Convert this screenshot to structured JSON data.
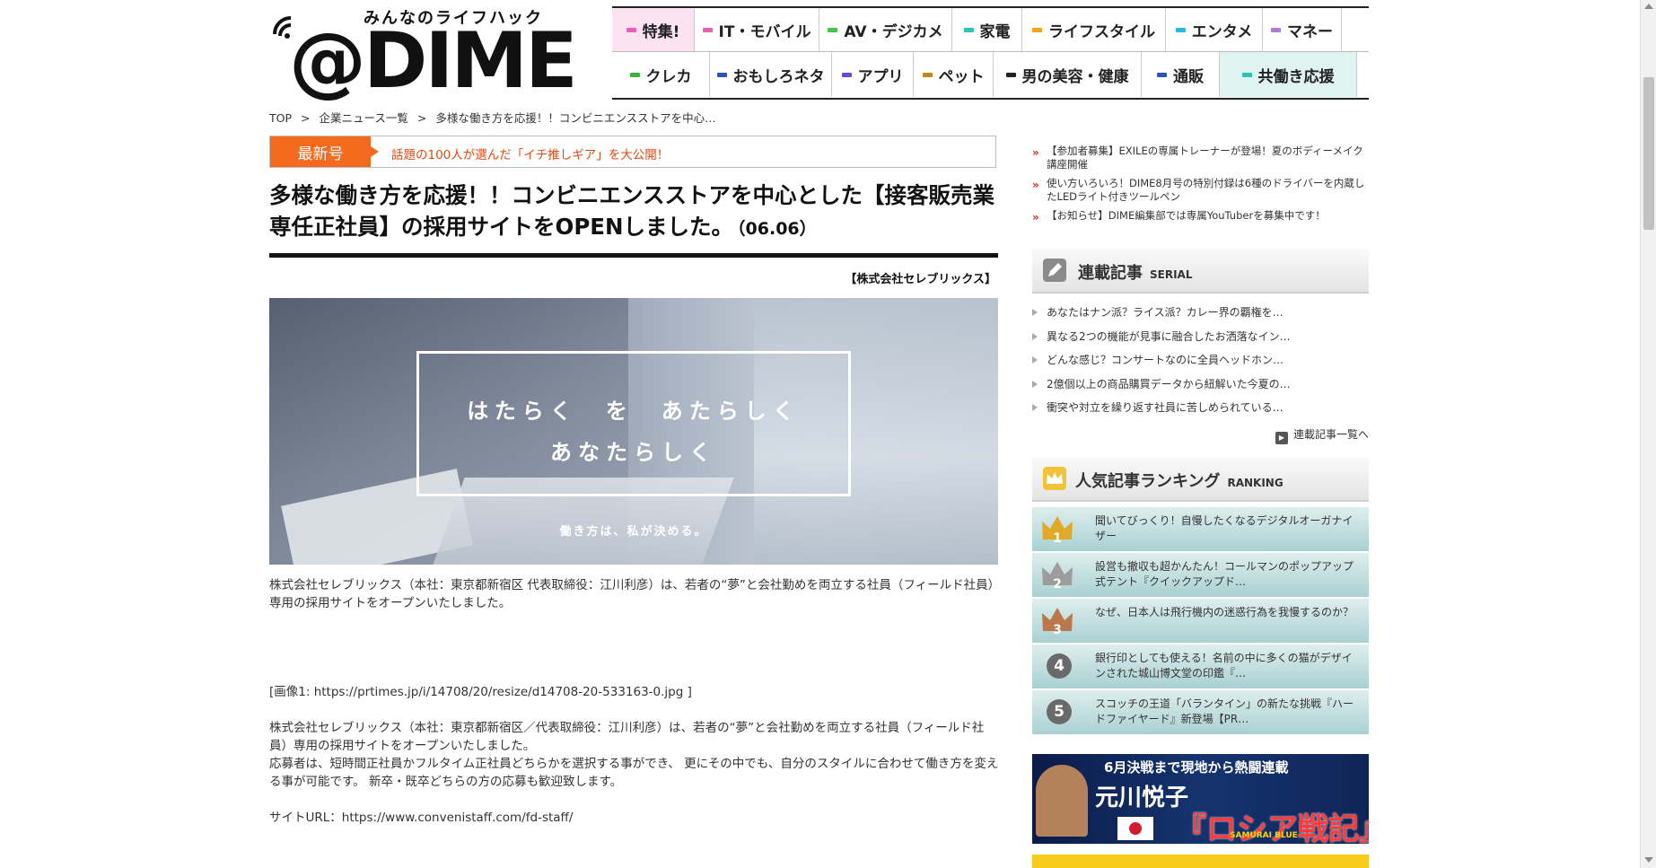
{
  "logo": {
    "tagline": "みんなのライフハック",
    "name": "@DIME"
  },
  "nav": {
    "row1": [
      {
        "label": "特集!",
        "color": "#e85fb5",
        "bg": "#fbe3f2"
      },
      {
        "label": "IT・モバイル",
        "color": "#e85fb5",
        "bg": "#ffffff"
      },
      {
        "label": "AV・デジカメ",
        "color": "#49c24a",
        "bg": "#ffffff"
      },
      {
        "label": "家電",
        "color": "#2ec2b0",
        "bg": "#ffffff"
      },
      {
        "label": "ライフスタイル",
        "color": "#f2a21d",
        "bg": "#ffffff"
      },
      {
        "label": "エンタメ",
        "color": "#2bb5e0",
        "bg": "#ffffff"
      },
      {
        "label": "マネー",
        "color": "#b17ad6",
        "bg": "#ffffff"
      }
    ],
    "row2": [
      {
        "label": "クレカ",
        "color": "#3bb03b",
        "bg": "#ffffff"
      },
      {
        "label": "おもしろネタ",
        "color": "#2a55b8",
        "bg": "#ffffff"
      },
      {
        "label": "アプリ",
        "color": "#6a4bc4",
        "bg": "#ffffff"
      },
      {
        "label": "ペット",
        "color": "#b88a22",
        "bg": "#ffffff"
      },
      {
        "label": "男の美容・健康",
        "color": "#222222",
        "bg": "#ffffff"
      },
      {
        "label": "通販",
        "color": "#2a55b8",
        "bg": "#ffffff"
      },
      {
        "label": "共働き応援",
        "color": "#2ec2b0",
        "bg": "#dff3f1"
      }
    ]
  },
  "breadcrumb": [
    "TOP",
    ">",
    "企業ニュース一覧",
    ">",
    "多様な働き方を応援！！コンビニエンスストアを中心…"
  ],
  "latest": {
    "tag": "最新号",
    "link": "話題の100人が選んだ「イチ推しギア」を大公開！"
  },
  "article": {
    "title": "多様な働き方を応援！！コンビニエンスストアを中心とした【接客販売業 専任正社員】の採用サイトをOPENしました。",
    "date": "（06.06）",
    "company": "【株式会社セレブリックス】",
    "hero": {
      "line1": "はたらく　を　あたらしく",
      "line2": "あなたらしく",
      "sub": "働き方は、私が決める。"
    },
    "para1": "株式会社セレブリックス（本社：東京都新宿区 代表取締役：江川利彦）は、若者の“夢”と会社勤めを両立する社員（フィールド社員）専用の採用サイトをオープンいたしました。",
    "image_ref": "[画像1: https://prtimes.jp/i/14708/20/resize/d14708-20-533163-0.jpg ]",
    "para2": "株式会社セレブリックス（本社：東京都新宿区／代表取締役：江川利彦）は、若者の“夢”と会社勤めを両立する社員（フィールド社員）専用の採用サイトをオープンいたしました。",
    "para3": "応募者は、短時間正社員かフルタイム正社員どちらかを選択する事ができ、 更にその中でも、自分のスタイルに合わせて働き方を変える事が可能です。 新卒・既卒どちらの方の応募も歓迎致します。",
    "site_url": "サイトURL：https://www.convenistaff.com/fd-staff/"
  },
  "sidebar": {
    "news": [
      "【参加者募集】EXILEの専属トレーナーが登場！夏のボディーメイク講座開催",
      "使い方いろいろ！DIME8月号の特別付録は6種のドライバーを内蔵したLEDライト付きツールペン",
      "【お知らせ】DIME編集部では専属YouTuberを募集中です！"
    ],
    "serial": {
      "title": "連載記事",
      "en": "SERIAL",
      "items": [
        "あなたはナン派？ライス派？カレー界の覇権を…",
        "異なる2つの機能が見事に融合したお洒落なイン…",
        "どんな感じ？コンサートなのに全員ヘッドホン…",
        "2億個以上の商品購買データから紐解いた今夏の…",
        "衝突や対立を繰り返す社員に苦しめられている…"
      ],
      "more": "連載記事一覧へ"
    },
    "ranking": {
      "title": "人気記事ランキング",
      "en": "RANKING",
      "items": [
        {
          "rank": "1",
          "text": "聞いてびっくり！自慢したくなるデジタルオーガナイザー"
        },
        {
          "rank": "2",
          "text": "設営も撤収も超かんたん！コールマンのポップアップ式テント『クイックアップド…"
        },
        {
          "rank": "3",
          "text": "なぜ、日本人は飛行機内の迷惑行為を我慢するのか？"
        },
        {
          "rank": "4",
          "text": "銀行印としても使える！名前の中に多くの猫がデザインされた城山博文堂の印鑑『…"
        },
        {
          "rank": "5",
          "text": "スコッチの王道「バランタイン」の新たな挑戦『ハードファイヤード』新登場【PR…"
        }
      ]
    },
    "banner": {
      "top": "6月決戦まで現地から熱闘連載",
      "name": "元川悦子",
      "big": "『ロシア戦記』",
      "sub": "SAMURAI BLUE"
    }
  }
}
